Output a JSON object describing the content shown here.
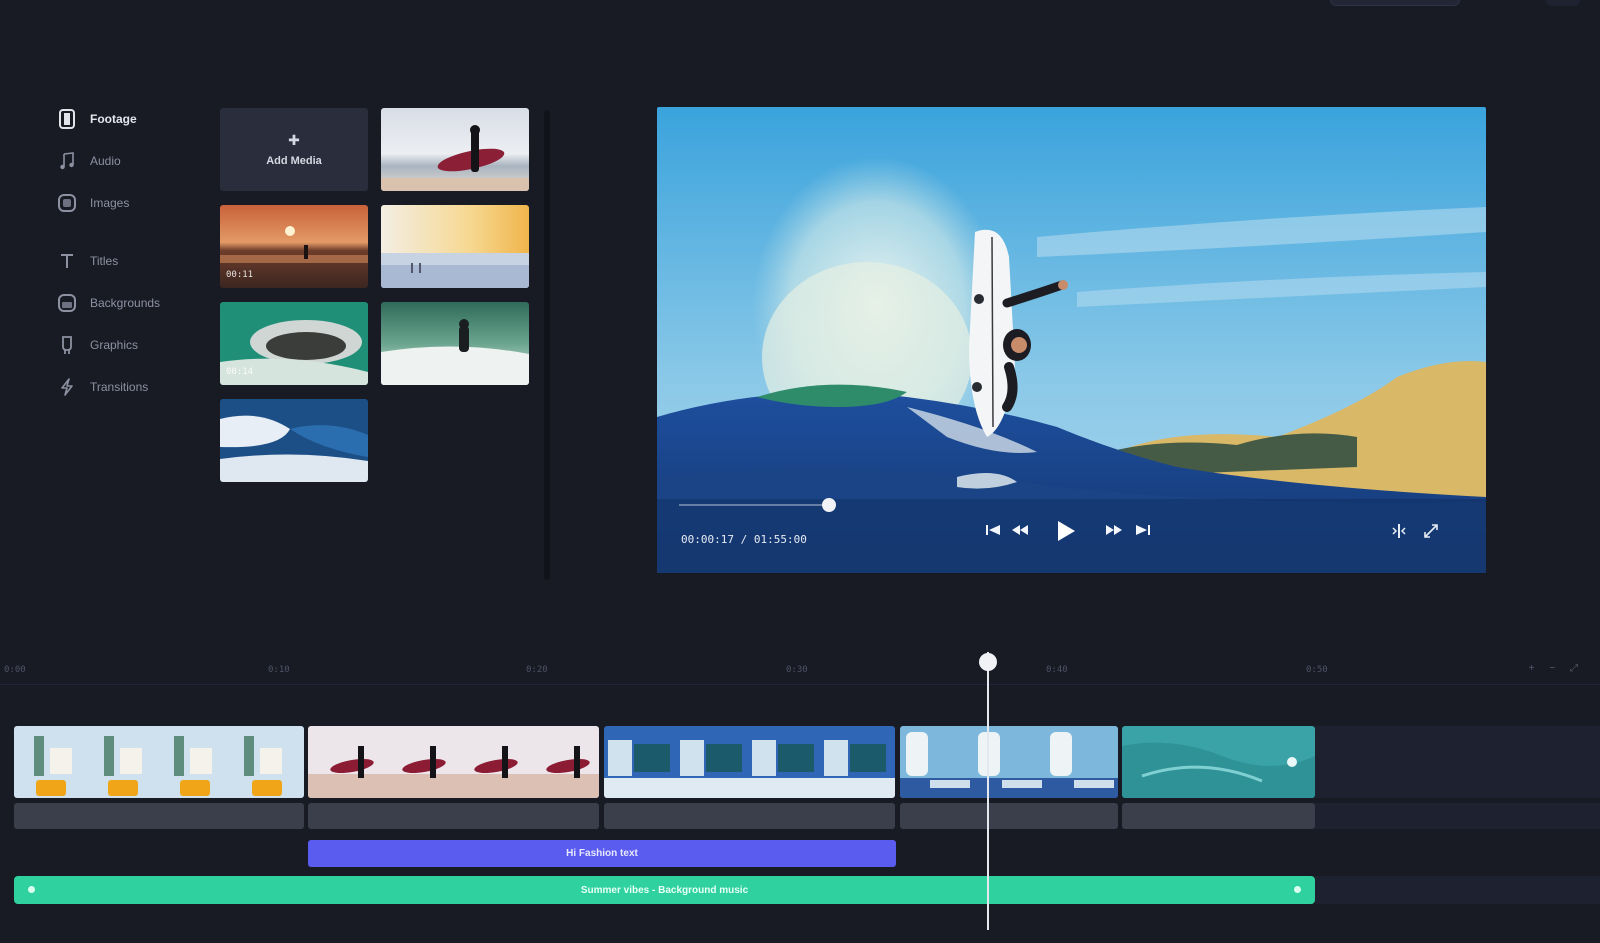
{
  "sidebar": {
    "items": [
      {
        "label": "Footage",
        "icon": "footage-icon",
        "active": true
      },
      {
        "label": "Audio",
        "icon": "music-note-icon"
      },
      {
        "label": "Images",
        "icon": "image-icon"
      },
      {
        "label": "Titles",
        "icon": "text-icon"
      },
      {
        "label": "Backgrounds",
        "icon": "background-icon"
      },
      {
        "label": "Graphics",
        "icon": "graphics-icon"
      },
      {
        "label": "Transitions",
        "icon": "transition-icon"
      }
    ]
  },
  "media": {
    "add_label": "Add Media",
    "tiles": [
      {
        "name": "surfer-with-board-beach",
        "duration": ""
      },
      {
        "name": "sunset-silhouette",
        "duration": "00:11"
      },
      {
        "name": "beach-golden-light",
        "duration": ""
      },
      {
        "name": "wave-barrel",
        "duration": "00:14"
      },
      {
        "name": "surfer-in-water",
        "duration": ""
      },
      {
        "name": "crashing-wave",
        "duration": ""
      }
    ]
  },
  "preview": {
    "timecode": "00:00:17 / 01:55:00",
    "progress_fraction": 0.2
  },
  "timeline": {
    "ruler_labels": [
      "0:00",
      "0:10",
      "0:20",
      "0:30",
      "0:40",
      "0:50"
    ],
    "zoom_label": "+ − ⤢",
    "video_clips": [
      "clip-desert",
      "clip-surfer-beach",
      "clip-ocean",
      "clip-wave-surf",
      "clip-aqua"
    ],
    "text_clip_label": "Hi Fashion text",
    "music_clip_label": "Summer vibes - Background music"
  },
  "colors": {
    "background": "#181a24",
    "text_clip": "#5a5cf0",
    "music_clip": "#2fd29e"
  }
}
